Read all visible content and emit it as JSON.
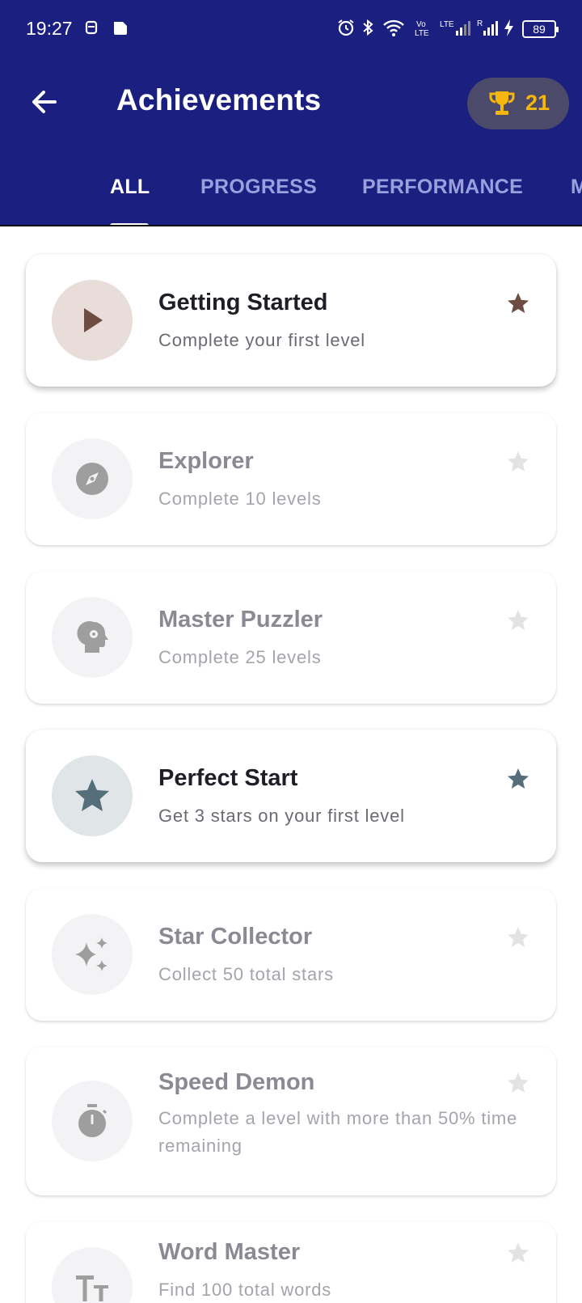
{
  "status_bar": {
    "time": "19:27",
    "battery": "89"
  },
  "header": {
    "title": "Achievements",
    "trophy_count": "21"
  },
  "tabs": [
    {
      "label": "ALL"
    },
    {
      "label": "PROGRESS"
    },
    {
      "label": "PERFORMANCE"
    },
    {
      "label": "M"
    }
  ],
  "achievements": [
    {
      "title": "Getting Started",
      "description": "Complete your first level",
      "icon": "play-icon",
      "earned": true,
      "color": "#6d4c41"
    },
    {
      "title": "Explorer",
      "description": "Complete 10 levels",
      "icon": "compass-icon",
      "earned": false,
      "color": "#9e9e9e"
    },
    {
      "title": "Master Puzzler",
      "description": "Complete 25 levels",
      "icon": "psychology-icon",
      "earned": false,
      "color": "#9e9e9e"
    },
    {
      "title": "Perfect Start",
      "description": "Get 3 stars on your first level",
      "icon": "star-icon",
      "earned": true,
      "color": "#546e7a"
    },
    {
      "title": "Star Collector",
      "description": "Collect 50 total stars",
      "icon": "sparkles-icon",
      "earned": false,
      "color": "#9e9e9e"
    },
    {
      "title": "Speed Demon",
      "description": "Complete a level with more than 50% time remaining",
      "icon": "timer-icon",
      "earned": false,
      "color": "#9e9e9e"
    },
    {
      "title": "Word Master",
      "description": "Find 100 total words",
      "icon": "text-size-icon",
      "earned": false,
      "color": "#9e9e9e"
    }
  ],
  "colors": {
    "header_bg": "#1a1f80",
    "trophy": "#f5b70a",
    "locked_star": "#e3e3e6"
  }
}
